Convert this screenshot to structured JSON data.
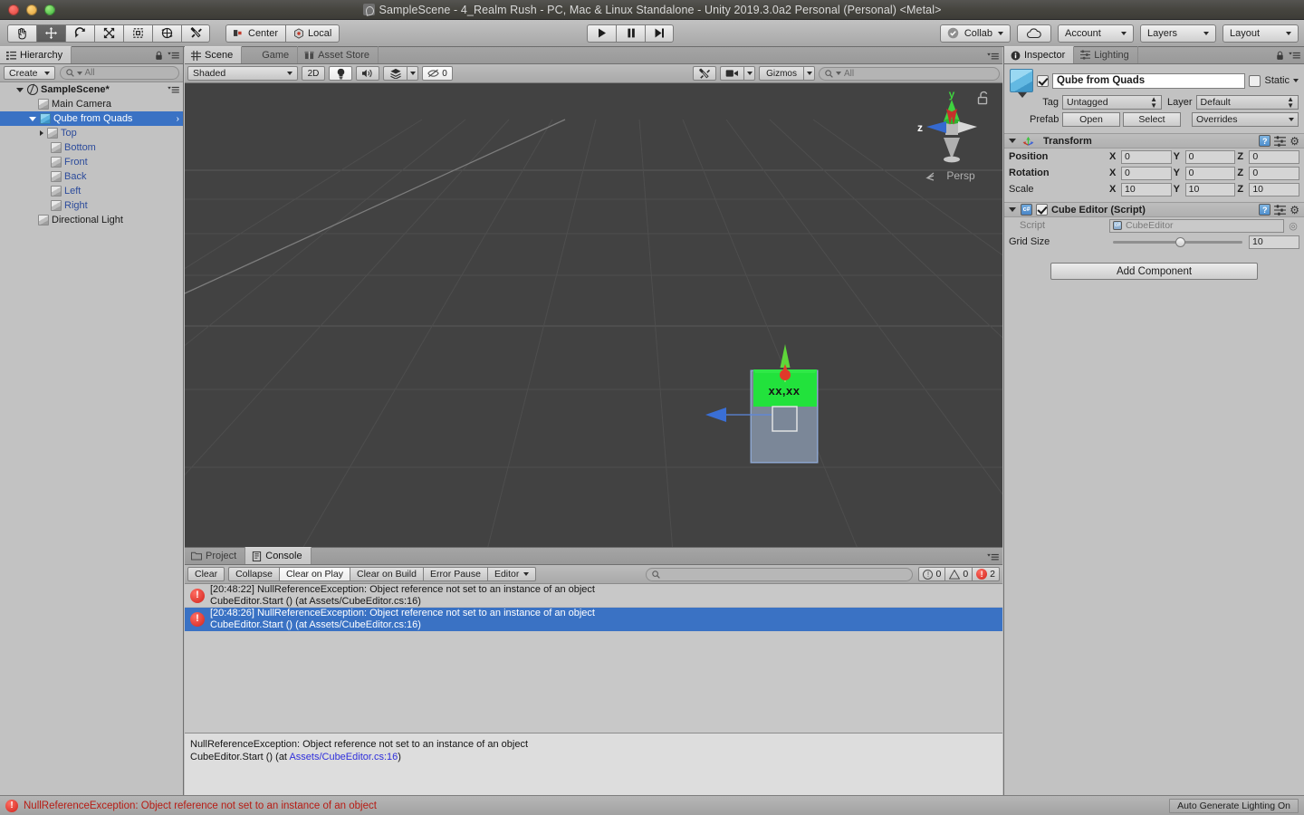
{
  "window": {
    "title": "SampleScene - 4_Realm Rush - PC, Mac & Linux Standalone - Unity 2019.3.0a2 Personal (Personal) <Metal>",
    "app_icon": "unity-icon"
  },
  "toolbar": {
    "tools": [
      {
        "name": "hand-tool",
        "icon": "hand-icon",
        "active": false
      },
      {
        "name": "move-tool",
        "icon": "move-icon",
        "active": true
      },
      {
        "name": "rotate-tool",
        "icon": "rotate-icon",
        "active": false
      },
      {
        "name": "scale-tool",
        "icon": "scale-icon",
        "active": false
      },
      {
        "name": "rect-tool",
        "icon": "rect-transform-icon",
        "active": false
      },
      {
        "name": "transform-tool",
        "icon": "transform-icon",
        "active": false
      },
      {
        "name": "custom-tool",
        "icon": "wrench-icon",
        "active": false
      }
    ],
    "pivot_label": "Center",
    "rotation_label": "Local",
    "play_label": "play-icon",
    "pause_label": "pause-icon",
    "step_label": "step-icon",
    "collab_label": "Collab",
    "cloud_label": "cloud-icon",
    "account_label": "Account",
    "layers_label": "Layers",
    "layout_label": "Layout"
  },
  "hierarchy": {
    "tab_label": "Hierarchy",
    "create_label": "Create",
    "search_placeholder": "All",
    "search_value": "",
    "scene_name": "SampleScene*",
    "items": [
      {
        "label": "Main Camera",
        "depth": 1,
        "icon": "gameobject-icon",
        "style": "normal",
        "twisty": "none"
      },
      {
        "label": "Qube from Quads",
        "depth": 1,
        "icon": "prefab-icon",
        "style": "selected",
        "twisty": "open"
      },
      {
        "label": "Top",
        "depth": 2,
        "icon": "gameobject-icon",
        "style": "prefab",
        "twisty": "closed"
      },
      {
        "label": "Bottom",
        "depth": 2,
        "icon": "gameobject-icon",
        "style": "prefab",
        "twisty": "none"
      },
      {
        "label": "Front",
        "depth": 2,
        "icon": "gameobject-icon",
        "style": "prefab",
        "twisty": "none"
      },
      {
        "label": "Back",
        "depth": 2,
        "icon": "gameobject-icon",
        "style": "prefab",
        "twisty": "none"
      },
      {
        "label": "Left",
        "depth": 2,
        "icon": "gameobject-icon",
        "style": "prefab",
        "twisty": "none"
      },
      {
        "label": "Right",
        "depth": 2,
        "icon": "gameobject-icon",
        "style": "prefab",
        "twisty": "none"
      },
      {
        "label": "Directional Light",
        "depth": 1,
        "icon": "light-icon",
        "style": "normal",
        "twisty": "none"
      }
    ]
  },
  "scene": {
    "tabs": [
      {
        "label": "Scene",
        "icon": "scene-icon",
        "active": true
      },
      {
        "label": "Game",
        "icon": "game-icon",
        "active": false
      },
      {
        "label": "Asset Store",
        "icon": "store-icon",
        "active": false
      }
    ],
    "draw_mode": "Shaded",
    "toggle_2d": "2D",
    "lighting_icon": "light-bulb-icon",
    "audio_icon": "speaker-icon",
    "fx_icon": "effects-icon",
    "hidden_count": "0",
    "tools_icon": "scene-tools-icon",
    "camera_icon": "scene-camera-icon",
    "gizmos_label": "Gizmos",
    "search_placeholder": "All",
    "gizmo_axes": {
      "up": "y",
      "left": "z",
      "projection": "Persp"
    },
    "object_label": "xx,xx"
  },
  "inspector": {
    "tabs": [
      {
        "label": "Inspector",
        "icon": "info-icon",
        "active": true
      },
      {
        "label": "Lighting",
        "icon": "lighting-icon",
        "active": false
      }
    ],
    "object_name": "Qube from Quads",
    "enabled": true,
    "static_label": "Static",
    "static_checked": false,
    "tag_label": "Tag",
    "tag_value": "Untagged",
    "layer_label": "Layer",
    "layer_value": "Default",
    "prefab_label": "Prefab",
    "prefab_open": "Open",
    "prefab_select": "Select",
    "prefab_overrides": "Overrides",
    "transform": {
      "title": "Transform",
      "rows": [
        {
          "name": "Position",
          "x": "0",
          "y": "0",
          "z": "0"
        },
        {
          "name": "Rotation",
          "x": "0",
          "y": "0",
          "z": "0"
        },
        {
          "name": "Scale",
          "x": "10",
          "y": "10",
          "z": "10"
        }
      ]
    },
    "script_component": {
      "title": "Cube Editor (Script)",
      "enabled": true,
      "script_label": "Script",
      "script_value": "CubeEditor",
      "grid_size_label": "Grid Size",
      "grid_size_value": "10",
      "grid_size_percent": 48
    },
    "add_component_label": "Add Component"
  },
  "console": {
    "tabs": [
      {
        "label": "Project",
        "icon": "folder-icon",
        "active": false
      },
      {
        "label": "Console",
        "icon": "console-icon",
        "active": true
      }
    ],
    "buttons": [
      "Clear",
      "Collapse",
      "Clear on Play",
      "Clear on Build",
      "Error Pause",
      "Editor"
    ],
    "active_buttons": [
      "Clear on Play"
    ],
    "search_placeholder": "",
    "counts": {
      "info": "0",
      "warning": "0",
      "error": "2"
    },
    "entries": [
      {
        "icon": "error-icon",
        "line1": "[20:48:22] NullReferenceException: Object reference not set to an instance of an object",
        "line2": "CubeEditor.Start () (at Assets/CubeEditor.cs:16)",
        "selected": false
      },
      {
        "icon": "error-icon",
        "line1": "[20:48:26] NullReferenceException: Object reference not set to an instance of an object",
        "line2": "CubeEditor.Start () (at Assets/CubeEditor.cs:16)",
        "selected": true
      }
    ],
    "detail": {
      "line1": "NullReferenceException: Object reference not set to an instance of an object",
      "line2_prefix": "CubeEditor.Start () (at ",
      "line2_link": "Assets/CubeEditor.cs:16",
      "line2_suffix": ")"
    }
  },
  "statusbar": {
    "message": "NullReferenceException: Object reference not set to an instance of an object",
    "right_label": "Auto Generate Lighting On"
  },
  "colors": {
    "selection_blue": "#3a72c4",
    "error_red": "#d0231c",
    "prefab_blue": "#2c4b9b",
    "cube_top_green": "#22e23c",
    "axis_green": "#5fd63a",
    "axis_blue": "#3a6fd6",
    "axis_red": "#e03a2a"
  }
}
